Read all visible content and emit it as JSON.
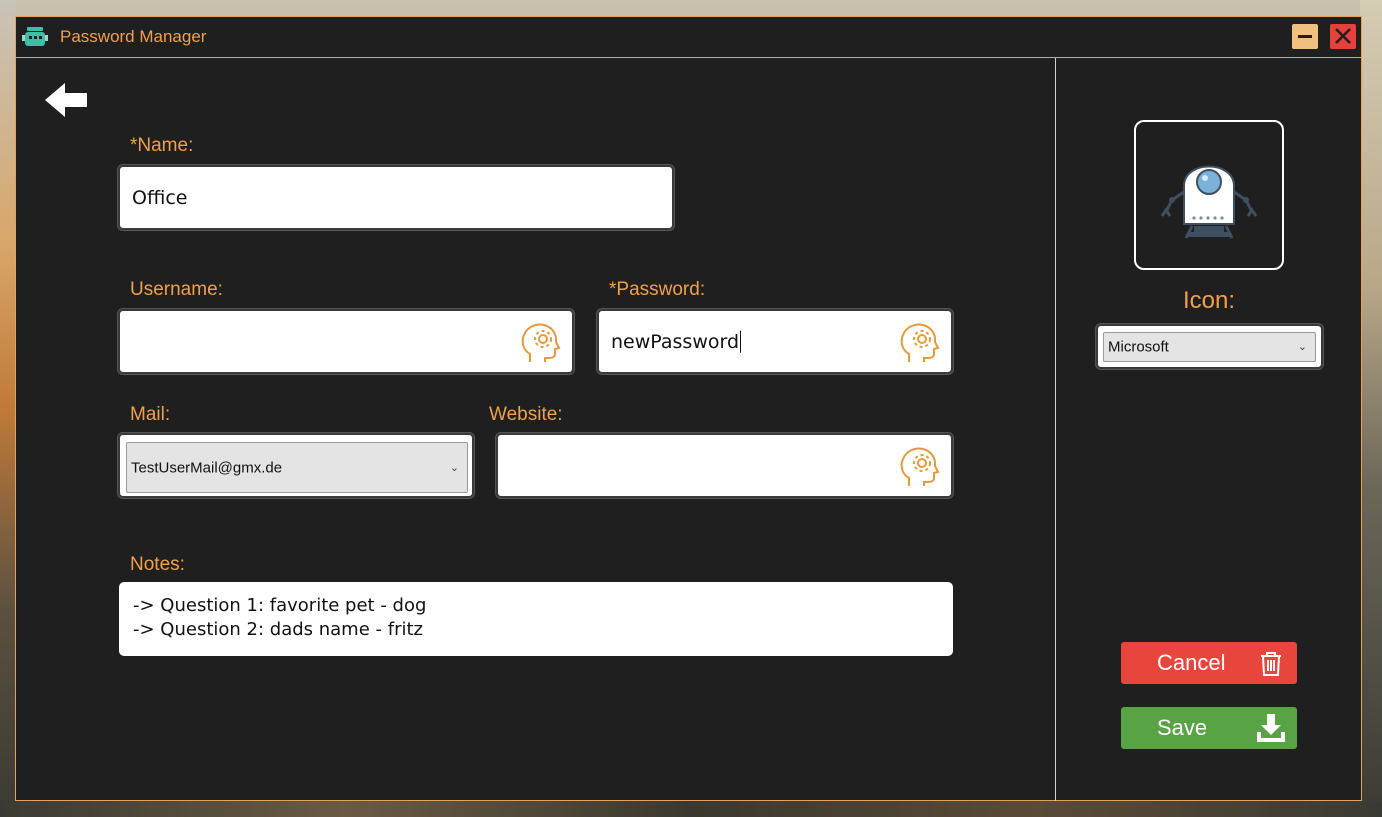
{
  "window": {
    "title": "Password Manager",
    "accent_color": "#f0a04a",
    "icons": {
      "app": "robot-app-icon",
      "minimize": "minimize-icon",
      "close": "close-icon",
      "back": "arrow-left-icon"
    }
  },
  "form": {
    "name": {
      "label": "*Name:",
      "value": "Office"
    },
    "username": {
      "label": "Username:",
      "value": "",
      "generator_icon": "head-gear-icon"
    },
    "password": {
      "label": "*Password:",
      "value": "newPassword",
      "generator_icon": "head-gear-icon"
    },
    "mail": {
      "label": "Mail:",
      "selected": "TestUserMail@gmx.de"
    },
    "website": {
      "label": "Website:",
      "value": "",
      "generator_icon": "head-gear-icon"
    },
    "notes": {
      "label": "Notes:",
      "lines": [
        "-> Question 1: favorite pet - dog",
        "-> Question 2: dads name - fritz"
      ]
    }
  },
  "sidebar": {
    "icon_label": "Icon:",
    "icon_selected": "Microsoft",
    "preview_icon": "robot-icon",
    "cancel_label": "Cancel",
    "cancel_icon": "trash-icon",
    "cancel_color": "#e8453c",
    "save_label": "Save",
    "save_icon": "download-icon",
    "save_color": "#58a344"
  }
}
